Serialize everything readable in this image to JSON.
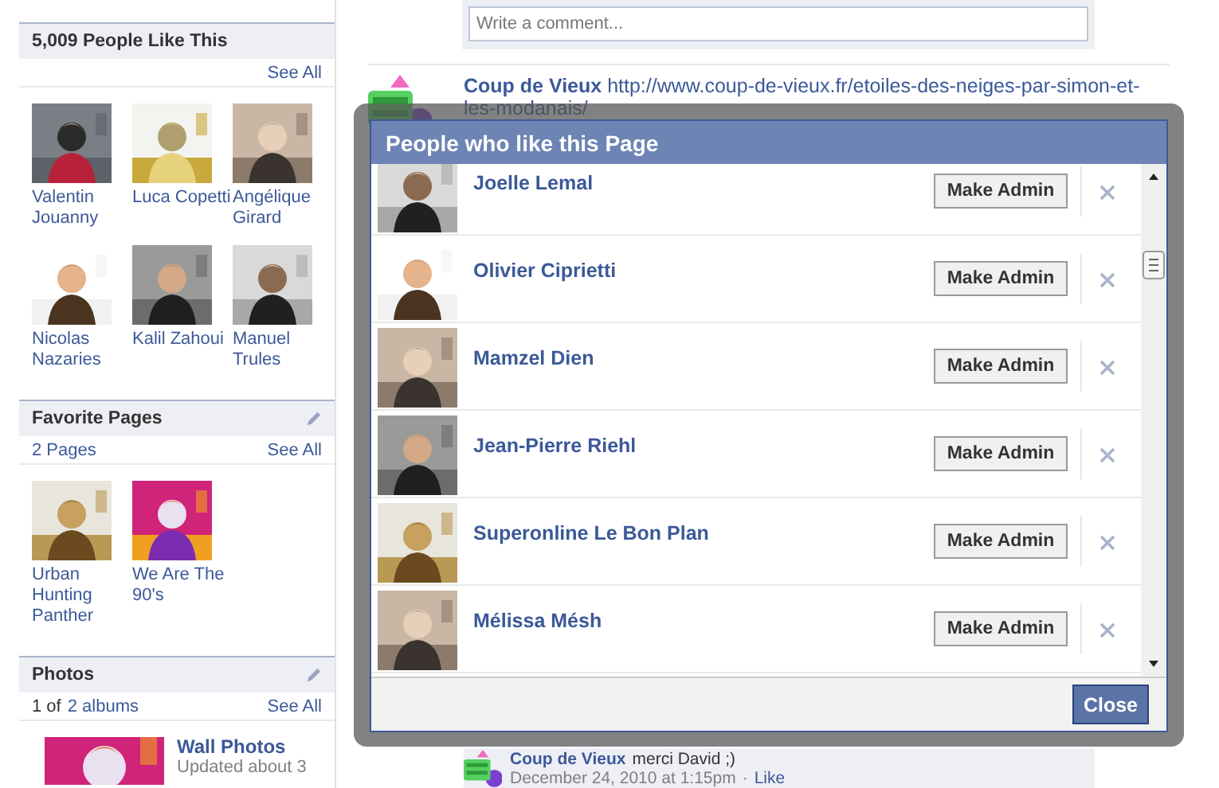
{
  "likes_box": {
    "title": "5,009 People Like This",
    "see_all": "See All",
    "people": [
      {
        "name": "Valentin Jouanny"
      },
      {
        "name": "Luca Copetti"
      },
      {
        "name": "Angélique Girard"
      },
      {
        "name": "Nicolas Nazaries"
      },
      {
        "name": "Kalil Zahoui"
      },
      {
        "name": "Manuel Trules"
      }
    ]
  },
  "favorite_pages": {
    "title": "Favorite Pages",
    "count": "2 Pages",
    "see_all": "See All",
    "pages": [
      {
        "name": "Urban Hunting Panther"
      },
      {
        "name": "We Are The 90's"
      }
    ]
  },
  "photos": {
    "title": "Photos",
    "count_prefix": "1 of",
    "count_link": "2 albums",
    "see_all": "See All",
    "albums": [
      {
        "title": "Wall Photos",
        "updated": "Updated about 3"
      }
    ]
  },
  "comment_field": {
    "placeholder": "Write a comment..."
  },
  "post": {
    "author": "Coup de Vieux",
    "link": "http://www.coup-de-vieux.fr/etoiles-des-neiges-par-simon-et-les-modanais/"
  },
  "comment": {
    "author": "Coup de Vieux",
    "text": "merci David ;)",
    "time": "December 24, 2010 at 1:15pm",
    "separator": "·",
    "action": "Like"
  },
  "dialog": {
    "title": "People who like this Page",
    "close": "Close",
    "people": [
      {
        "name": "Joelle Lemal",
        "action": "Make Admin"
      },
      {
        "name": "Olivier Ciprietti",
        "action": "Make Admin"
      },
      {
        "name": "Mamzel Dien",
        "action": "Make Admin"
      },
      {
        "name": "Jean-Pierre Riehl",
        "action": "Make Admin"
      },
      {
        "name": "Superonline Le Bon Plan",
        "action": "Make Admin"
      },
      {
        "name": "Mélissa Mésh",
        "action": "Make Admin"
      }
    ]
  }
}
